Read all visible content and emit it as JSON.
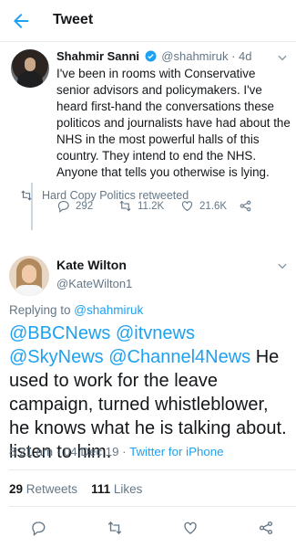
{
  "header": {
    "title": "Tweet"
  },
  "tweet1": {
    "name": "Shahmir Sanni",
    "handle": "@shahmiruk",
    "separator": "·",
    "time": "4d",
    "text": "I've been in rooms with Conservative senior advisors and policymakers. I've heard first-hand the conversations these politicos and journalists have had about the NHS in the most powerful halls of this country. They intend to end the NHS. Anyone that tells you otherwise is lying.",
    "replies": "292",
    "retweets": "11.2K",
    "likes": "21.6K"
  },
  "retweet_note": "Hard Copy Politics retweeted",
  "tweet2": {
    "name": "Kate Wilton",
    "handle": "@KateWilton1",
    "replying_prefix": "Replying to ",
    "replying_handle": "@shahmiruk",
    "mentions": "@BBCNews @itvnews @SkyNews @Channel4News",
    "text": " He used to work for the leave campaign, turned whistleblower, he knows what he is talking about. listen to him.",
    "time": "8:21 am · 04 Dec 19 · ",
    "client": "Twitter for iPhone",
    "retweet_count": "29",
    "retweet_label": " Retweets",
    "like_count": "111",
    "like_label": " Likes"
  },
  "colors": {
    "accent": "#1da1f2",
    "muted": "#657786",
    "text": "#14171a",
    "divider": "#e6ecf0"
  },
  "icons": [
    "back-arrow-icon",
    "verified-badge-icon",
    "chevron-down-icon",
    "reply-icon",
    "retweet-icon",
    "like-icon",
    "share-icon"
  ]
}
